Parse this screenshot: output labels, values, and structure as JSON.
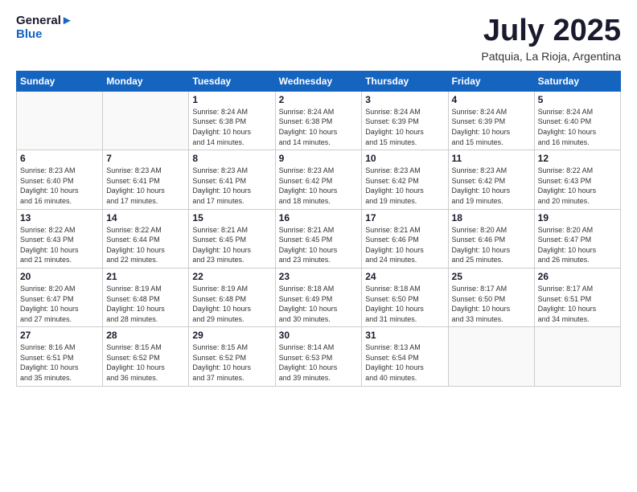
{
  "logo": {
    "line1": "General",
    "line2": "Blue"
  },
  "header": {
    "month": "July 2025",
    "location": "Patquia, La Rioja, Argentina"
  },
  "weekdays": [
    "Sunday",
    "Monday",
    "Tuesday",
    "Wednesday",
    "Thursday",
    "Friday",
    "Saturday"
  ],
  "weeks": [
    [
      {
        "day": "",
        "info": ""
      },
      {
        "day": "",
        "info": ""
      },
      {
        "day": "1",
        "info": "Sunrise: 8:24 AM\nSunset: 6:38 PM\nDaylight: 10 hours\nand 14 minutes."
      },
      {
        "day": "2",
        "info": "Sunrise: 8:24 AM\nSunset: 6:38 PM\nDaylight: 10 hours\nand 14 minutes."
      },
      {
        "day": "3",
        "info": "Sunrise: 8:24 AM\nSunset: 6:39 PM\nDaylight: 10 hours\nand 15 minutes."
      },
      {
        "day": "4",
        "info": "Sunrise: 8:24 AM\nSunset: 6:39 PM\nDaylight: 10 hours\nand 15 minutes."
      },
      {
        "day": "5",
        "info": "Sunrise: 8:24 AM\nSunset: 6:40 PM\nDaylight: 10 hours\nand 16 minutes."
      }
    ],
    [
      {
        "day": "6",
        "info": "Sunrise: 8:23 AM\nSunset: 6:40 PM\nDaylight: 10 hours\nand 16 minutes."
      },
      {
        "day": "7",
        "info": "Sunrise: 8:23 AM\nSunset: 6:41 PM\nDaylight: 10 hours\nand 17 minutes."
      },
      {
        "day": "8",
        "info": "Sunrise: 8:23 AM\nSunset: 6:41 PM\nDaylight: 10 hours\nand 17 minutes."
      },
      {
        "day": "9",
        "info": "Sunrise: 8:23 AM\nSunset: 6:42 PM\nDaylight: 10 hours\nand 18 minutes."
      },
      {
        "day": "10",
        "info": "Sunrise: 8:23 AM\nSunset: 6:42 PM\nDaylight: 10 hours\nand 19 minutes."
      },
      {
        "day": "11",
        "info": "Sunrise: 8:23 AM\nSunset: 6:42 PM\nDaylight: 10 hours\nand 19 minutes."
      },
      {
        "day": "12",
        "info": "Sunrise: 8:22 AM\nSunset: 6:43 PM\nDaylight: 10 hours\nand 20 minutes."
      }
    ],
    [
      {
        "day": "13",
        "info": "Sunrise: 8:22 AM\nSunset: 6:43 PM\nDaylight: 10 hours\nand 21 minutes."
      },
      {
        "day": "14",
        "info": "Sunrise: 8:22 AM\nSunset: 6:44 PM\nDaylight: 10 hours\nand 22 minutes."
      },
      {
        "day": "15",
        "info": "Sunrise: 8:21 AM\nSunset: 6:45 PM\nDaylight: 10 hours\nand 23 minutes."
      },
      {
        "day": "16",
        "info": "Sunrise: 8:21 AM\nSunset: 6:45 PM\nDaylight: 10 hours\nand 23 minutes."
      },
      {
        "day": "17",
        "info": "Sunrise: 8:21 AM\nSunset: 6:46 PM\nDaylight: 10 hours\nand 24 minutes."
      },
      {
        "day": "18",
        "info": "Sunrise: 8:20 AM\nSunset: 6:46 PM\nDaylight: 10 hours\nand 25 minutes."
      },
      {
        "day": "19",
        "info": "Sunrise: 8:20 AM\nSunset: 6:47 PM\nDaylight: 10 hours\nand 26 minutes."
      }
    ],
    [
      {
        "day": "20",
        "info": "Sunrise: 8:20 AM\nSunset: 6:47 PM\nDaylight: 10 hours\nand 27 minutes."
      },
      {
        "day": "21",
        "info": "Sunrise: 8:19 AM\nSunset: 6:48 PM\nDaylight: 10 hours\nand 28 minutes."
      },
      {
        "day": "22",
        "info": "Sunrise: 8:19 AM\nSunset: 6:48 PM\nDaylight: 10 hours\nand 29 minutes."
      },
      {
        "day": "23",
        "info": "Sunrise: 8:18 AM\nSunset: 6:49 PM\nDaylight: 10 hours\nand 30 minutes."
      },
      {
        "day": "24",
        "info": "Sunrise: 8:18 AM\nSunset: 6:50 PM\nDaylight: 10 hours\nand 31 minutes."
      },
      {
        "day": "25",
        "info": "Sunrise: 8:17 AM\nSunset: 6:50 PM\nDaylight: 10 hours\nand 33 minutes."
      },
      {
        "day": "26",
        "info": "Sunrise: 8:17 AM\nSunset: 6:51 PM\nDaylight: 10 hours\nand 34 minutes."
      }
    ],
    [
      {
        "day": "27",
        "info": "Sunrise: 8:16 AM\nSunset: 6:51 PM\nDaylight: 10 hours\nand 35 minutes."
      },
      {
        "day": "28",
        "info": "Sunrise: 8:15 AM\nSunset: 6:52 PM\nDaylight: 10 hours\nand 36 minutes."
      },
      {
        "day": "29",
        "info": "Sunrise: 8:15 AM\nSunset: 6:52 PM\nDaylight: 10 hours\nand 37 minutes."
      },
      {
        "day": "30",
        "info": "Sunrise: 8:14 AM\nSunset: 6:53 PM\nDaylight: 10 hours\nand 39 minutes."
      },
      {
        "day": "31",
        "info": "Sunrise: 8:13 AM\nSunset: 6:54 PM\nDaylight: 10 hours\nand 40 minutes."
      },
      {
        "day": "",
        "info": ""
      },
      {
        "day": "",
        "info": ""
      }
    ]
  ]
}
